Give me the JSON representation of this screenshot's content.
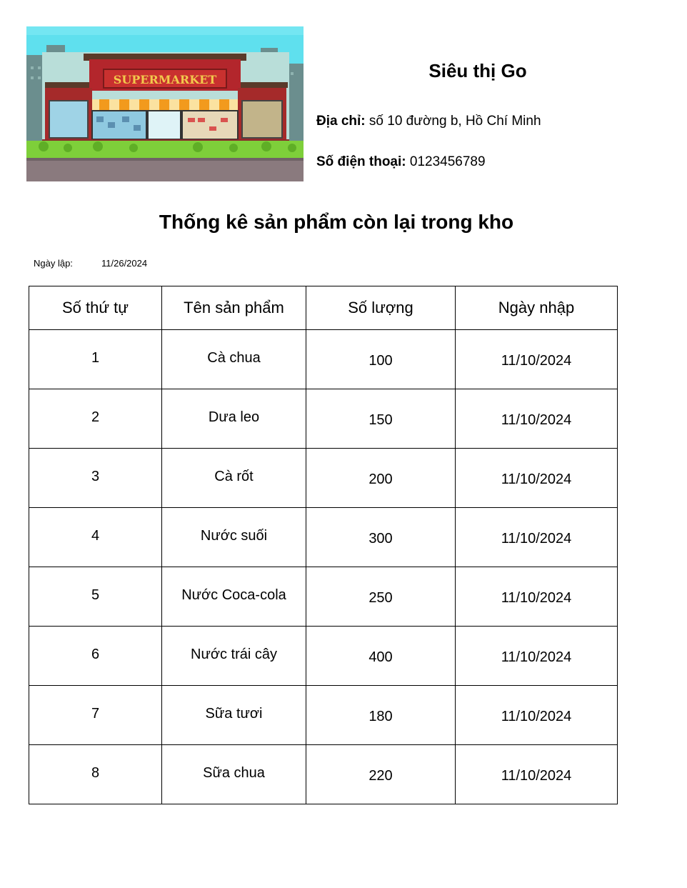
{
  "store": {
    "image_sign": "SUPERMARKET",
    "name": "Siêu thị Go",
    "address_label": "Địa chỉ:",
    "address": "số 10 đường b, Hồ Chí Minh",
    "phone_label": "Số điện thoại:",
    "phone": "0123456789"
  },
  "report": {
    "title": "Thống kê sản phẩm còn lại trong kho",
    "date_label": "Ngày lập:",
    "date": "11/26/2024"
  },
  "table": {
    "headers": [
      "Số thứ tự",
      "Tên sản phẩm",
      "Số lượng",
      "Ngày nhập"
    ],
    "rows": [
      [
        "1",
        "Cà chua",
        "100",
        "11/10/2024"
      ],
      [
        "2",
        "Dưa leo",
        "150",
        "11/10/2024"
      ],
      [
        "3",
        "Cà rốt",
        "200",
        "11/10/2024"
      ],
      [
        "4",
        "Nước suối",
        "300",
        "11/10/2024"
      ],
      [
        "5",
        "Nước Coca-cola",
        "250",
        "11/10/2024"
      ],
      [
        "6",
        "Nước trái cây",
        "400",
        "11/10/2024"
      ],
      [
        "7",
        "Sữa tươi",
        "180",
        "11/10/2024"
      ],
      [
        "8",
        "Sữa chua",
        "220",
        "11/10/2024"
      ]
    ]
  }
}
